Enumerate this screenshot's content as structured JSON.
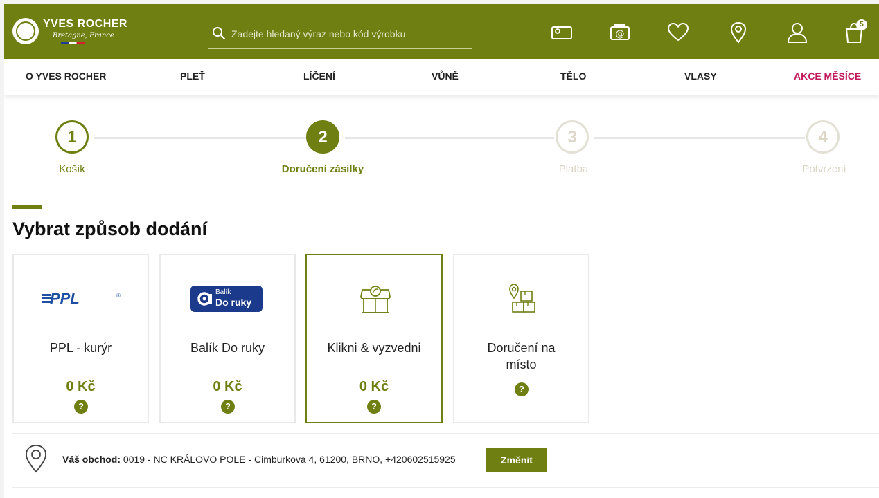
{
  "brand": {
    "name": "YVES ROCHER",
    "tagline": "Bretagne, France"
  },
  "search": {
    "placeholder": "Zadejte hledaný výraz nebo kód výrobku"
  },
  "header_icons": {
    "cart_count": "5"
  },
  "nav": {
    "items": [
      "O YVES ROCHER",
      "PLEŤ",
      "LÍČENÍ",
      "VŮNĚ",
      "TĚLO",
      "VLASY",
      "AKCE MĚSÍCE"
    ]
  },
  "steps": [
    {
      "number": "1",
      "label": "Košík",
      "state": "done"
    },
    {
      "number": "2",
      "label": "Doručení zásilky",
      "state": "active"
    },
    {
      "number": "3",
      "label": "Platba",
      "state": "future"
    },
    {
      "number": "4",
      "label": "Potvrzení",
      "state": "future"
    }
  ],
  "section": {
    "title": "Vybrat způsob dodání"
  },
  "delivery_options": [
    {
      "logo_text": "PPL",
      "name": "PPL - kurýr",
      "price": "0 Kč",
      "help": "?",
      "selected": false
    },
    {
      "logo_text_small": "Balík",
      "logo_text_big": "Do ruky",
      "name": "Balík Do ruky",
      "price": "0 Kč",
      "help": "?",
      "selected": false
    },
    {
      "name": "Klikni & vyzvedni",
      "price": "0 Kč",
      "help": "?",
      "selected": true
    },
    {
      "name": "Doručení na místo",
      "help": "?",
      "selected": false
    }
  ],
  "store": {
    "label": "Váš obchod:",
    "value": "0019 - NC KRÁLOVO POLE - Cimburkova 4, 61200, BRNO, +420602515925",
    "button": "Změnit"
  },
  "colors": {
    "brand_green": "#6f7f12",
    "accent_pink": "#c2185b",
    "step_future": "#d9d4c4",
    "balik_blue": "#1c3a8c"
  }
}
